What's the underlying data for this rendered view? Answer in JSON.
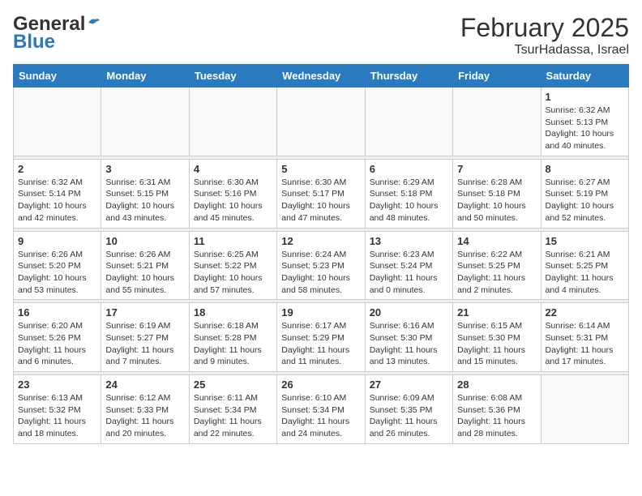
{
  "header": {
    "logo_general": "General",
    "logo_blue": "Blue",
    "month": "February 2025",
    "location": "TsurHadassa, Israel"
  },
  "weekdays": [
    "Sunday",
    "Monday",
    "Tuesday",
    "Wednesday",
    "Thursday",
    "Friday",
    "Saturday"
  ],
  "weeks": [
    [
      {
        "day": "",
        "info": ""
      },
      {
        "day": "",
        "info": ""
      },
      {
        "day": "",
        "info": ""
      },
      {
        "day": "",
        "info": ""
      },
      {
        "day": "",
        "info": ""
      },
      {
        "day": "",
        "info": ""
      },
      {
        "day": "1",
        "info": "Sunrise: 6:32 AM\nSunset: 5:13 PM\nDaylight: 10 hours\nand 40 minutes."
      }
    ],
    [
      {
        "day": "2",
        "info": "Sunrise: 6:32 AM\nSunset: 5:14 PM\nDaylight: 10 hours\nand 42 minutes."
      },
      {
        "day": "3",
        "info": "Sunrise: 6:31 AM\nSunset: 5:15 PM\nDaylight: 10 hours\nand 43 minutes."
      },
      {
        "day": "4",
        "info": "Sunrise: 6:30 AM\nSunset: 5:16 PM\nDaylight: 10 hours\nand 45 minutes."
      },
      {
        "day": "5",
        "info": "Sunrise: 6:30 AM\nSunset: 5:17 PM\nDaylight: 10 hours\nand 47 minutes."
      },
      {
        "day": "6",
        "info": "Sunrise: 6:29 AM\nSunset: 5:18 PM\nDaylight: 10 hours\nand 48 minutes."
      },
      {
        "day": "7",
        "info": "Sunrise: 6:28 AM\nSunset: 5:18 PM\nDaylight: 10 hours\nand 50 minutes."
      },
      {
        "day": "8",
        "info": "Sunrise: 6:27 AM\nSunset: 5:19 PM\nDaylight: 10 hours\nand 52 minutes."
      }
    ],
    [
      {
        "day": "9",
        "info": "Sunrise: 6:26 AM\nSunset: 5:20 PM\nDaylight: 10 hours\nand 53 minutes."
      },
      {
        "day": "10",
        "info": "Sunrise: 6:26 AM\nSunset: 5:21 PM\nDaylight: 10 hours\nand 55 minutes."
      },
      {
        "day": "11",
        "info": "Sunrise: 6:25 AM\nSunset: 5:22 PM\nDaylight: 10 hours\nand 57 minutes."
      },
      {
        "day": "12",
        "info": "Sunrise: 6:24 AM\nSunset: 5:23 PM\nDaylight: 10 hours\nand 58 minutes."
      },
      {
        "day": "13",
        "info": "Sunrise: 6:23 AM\nSunset: 5:24 PM\nDaylight: 11 hours\nand 0 minutes."
      },
      {
        "day": "14",
        "info": "Sunrise: 6:22 AM\nSunset: 5:25 PM\nDaylight: 11 hours\nand 2 minutes."
      },
      {
        "day": "15",
        "info": "Sunrise: 6:21 AM\nSunset: 5:25 PM\nDaylight: 11 hours\nand 4 minutes."
      }
    ],
    [
      {
        "day": "16",
        "info": "Sunrise: 6:20 AM\nSunset: 5:26 PM\nDaylight: 11 hours\nand 6 minutes."
      },
      {
        "day": "17",
        "info": "Sunrise: 6:19 AM\nSunset: 5:27 PM\nDaylight: 11 hours\nand 7 minutes."
      },
      {
        "day": "18",
        "info": "Sunrise: 6:18 AM\nSunset: 5:28 PM\nDaylight: 11 hours\nand 9 minutes."
      },
      {
        "day": "19",
        "info": "Sunrise: 6:17 AM\nSunset: 5:29 PM\nDaylight: 11 hours\nand 11 minutes."
      },
      {
        "day": "20",
        "info": "Sunrise: 6:16 AM\nSunset: 5:30 PM\nDaylight: 11 hours\nand 13 minutes."
      },
      {
        "day": "21",
        "info": "Sunrise: 6:15 AM\nSunset: 5:30 PM\nDaylight: 11 hours\nand 15 minutes."
      },
      {
        "day": "22",
        "info": "Sunrise: 6:14 AM\nSunset: 5:31 PM\nDaylight: 11 hours\nand 17 minutes."
      }
    ],
    [
      {
        "day": "23",
        "info": "Sunrise: 6:13 AM\nSunset: 5:32 PM\nDaylight: 11 hours\nand 18 minutes."
      },
      {
        "day": "24",
        "info": "Sunrise: 6:12 AM\nSunset: 5:33 PM\nDaylight: 11 hours\nand 20 minutes."
      },
      {
        "day": "25",
        "info": "Sunrise: 6:11 AM\nSunset: 5:34 PM\nDaylight: 11 hours\nand 22 minutes."
      },
      {
        "day": "26",
        "info": "Sunrise: 6:10 AM\nSunset: 5:34 PM\nDaylight: 11 hours\nand 24 minutes."
      },
      {
        "day": "27",
        "info": "Sunrise: 6:09 AM\nSunset: 5:35 PM\nDaylight: 11 hours\nand 26 minutes."
      },
      {
        "day": "28",
        "info": "Sunrise: 6:08 AM\nSunset: 5:36 PM\nDaylight: 11 hours\nand 28 minutes."
      },
      {
        "day": "",
        "info": ""
      }
    ]
  ]
}
